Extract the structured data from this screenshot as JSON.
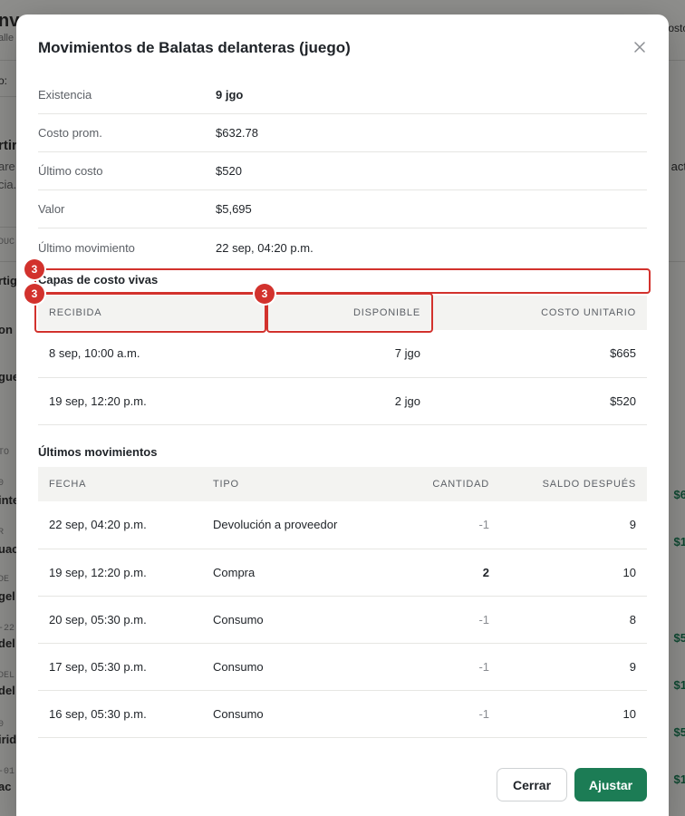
{
  "background": {
    "left_fragments": [
      "nv",
      "alle",
      "o:",
      "rtir",
      "are",
      "cia.",
      "DUC",
      "rtig",
      "on",
      "gue",
      "TO",
      "0",
      "inte",
      "R",
      "uac",
      "DE",
      "gel",
      "-22",
      "del",
      "DEL",
      "del",
      "0",
      "irid",
      "-01",
      "ac"
    ],
    "right_fragments": [
      "osto",
      "act",
      "$6",
      "$1",
      "$5",
      "$1",
      "$5",
      "$1"
    ]
  },
  "modal": {
    "title": "Movimientos de Balatas delanteras (juego)",
    "close_icon": "close-icon",
    "info": [
      {
        "label": "Existencia",
        "value": "9 jgo"
      },
      {
        "label": "Costo prom.",
        "value": "$632.78"
      },
      {
        "label": "Último costo",
        "value": "$520"
      },
      {
        "label": "Valor",
        "value": "$5,695"
      },
      {
        "label": "Último movimiento",
        "value": "22 sep, 04:20 p.m."
      }
    ],
    "layers": {
      "title": "Capas de costo vivas",
      "headers": [
        "Recibida",
        "Disponible",
        "Costo unitario"
      ],
      "rows": [
        {
          "received": "8 sep, 10:00 a.m.",
          "available": "7 jgo",
          "cost": "$665"
        },
        {
          "received": "19 sep, 12:20 p.m.",
          "available": "2 jgo",
          "cost": "$520"
        }
      ]
    },
    "movements": {
      "title": "Últimos movimientos",
      "headers": [
        "Fecha",
        "Tipo",
        "Cantidad",
        "Saldo después"
      ],
      "rows": [
        {
          "date": "22 sep, 04:20 p.m.",
          "type": "Devolución a proveedor",
          "qty": "-1",
          "balance": "9"
        },
        {
          "date": "19 sep, 12:20 p.m.",
          "type": "Compra",
          "qty": "2",
          "balance": "10"
        },
        {
          "date": "20 sep, 05:30 p.m.",
          "type": "Consumo",
          "qty": "-1",
          "balance": "8"
        },
        {
          "date": "17 sep, 05:30 p.m.",
          "type": "Consumo",
          "qty": "-1",
          "balance": "9"
        },
        {
          "date": "16 sep, 05:30 p.m.",
          "type": "Consumo",
          "qty": "-1",
          "balance": "10"
        }
      ]
    },
    "buttons": {
      "close": "Cerrar",
      "adjust": "Ajustar"
    },
    "annotations": [
      "3",
      "3",
      "3"
    ]
  },
  "colors": {
    "accent": "#1c7c55",
    "annotation": "#d2322d"
  }
}
